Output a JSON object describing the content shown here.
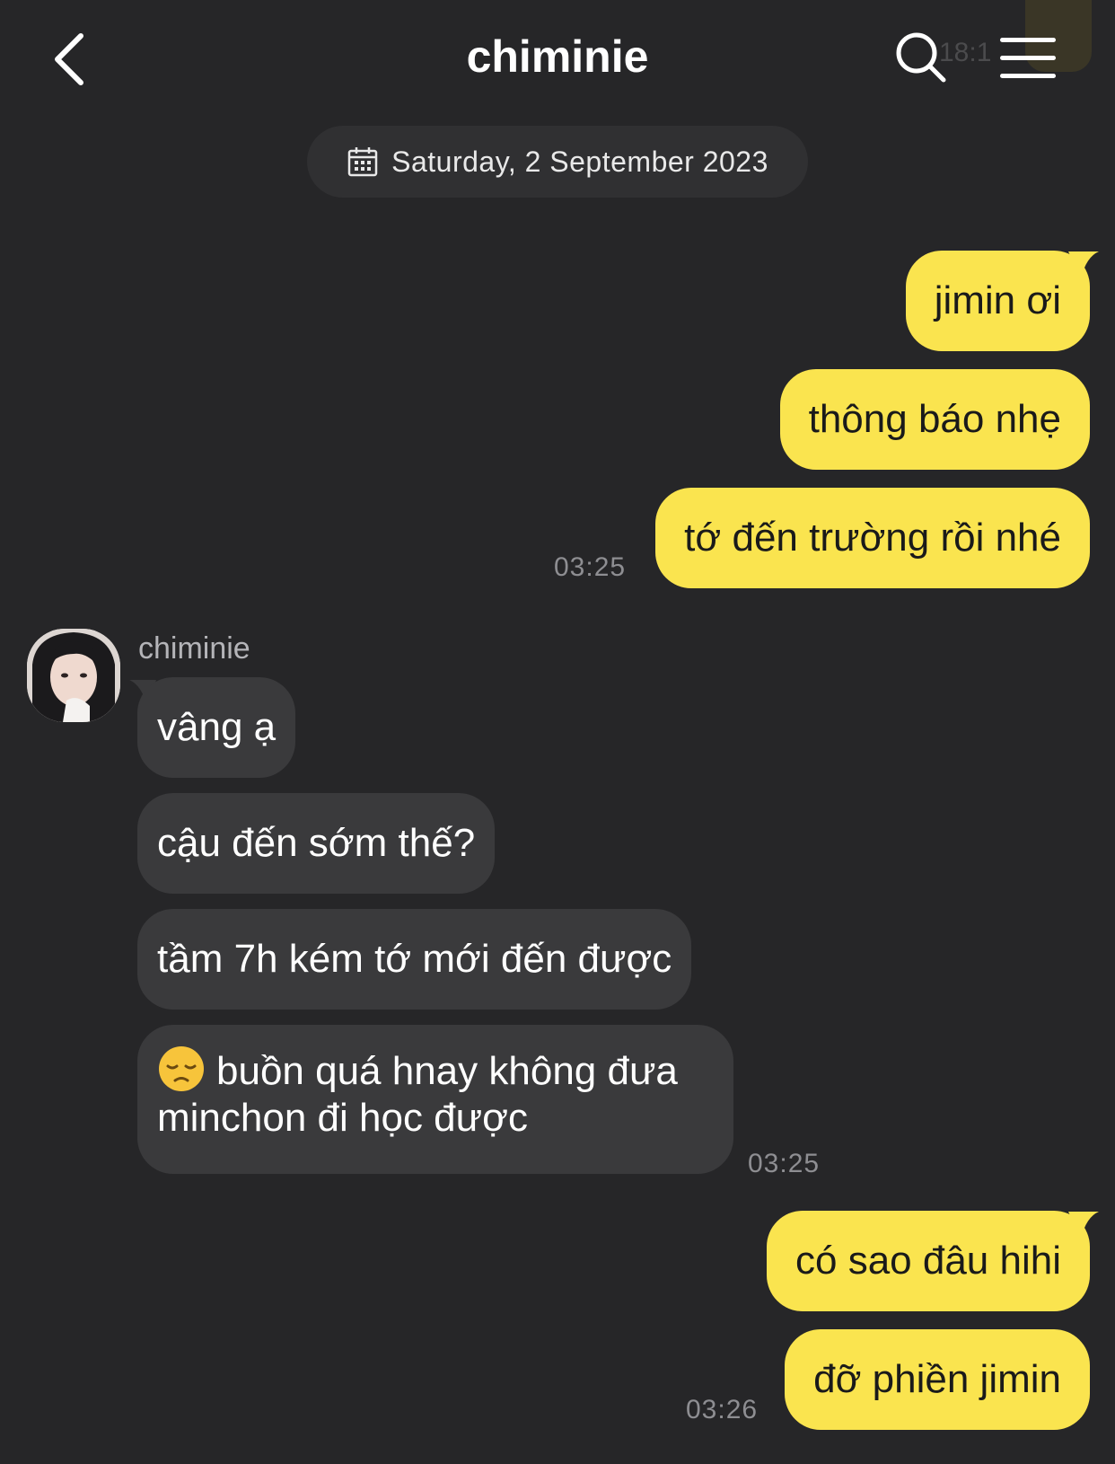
{
  "header": {
    "title": "chiminie",
    "ghost_time": "18:1",
    "back_icon": "chevron-left-icon",
    "search_icon": "search-icon",
    "menu_icon": "hamburger-menu-icon"
  },
  "date_divider": {
    "label": "Saturday, 2 September 2023",
    "icon": "calendar-icon"
  },
  "colors": {
    "background": "#262628",
    "my_bubble": "#fae44f",
    "their_bubble": "#3a3a3c",
    "timestamp": "#8e8e92"
  },
  "messages": {
    "me_1": {
      "text": "jimin ơi"
    },
    "me_2": {
      "text": "thông báo nhẹ"
    },
    "me_3": {
      "text": "tớ đến trường rồi nhé",
      "time": "03:25"
    },
    "them_sender": "chiminie",
    "them_1": {
      "text": "vâng ạ"
    },
    "them_2": {
      "text": "cậu đến sớm thế?"
    },
    "them_3": {
      "text": "tầm 7h kém tớ mới đến được"
    },
    "them_4": {
      "emoji": "pensive-face",
      "line1": "buồn quá hnay không đưa",
      "line2": "minchon đi học được",
      "time": "03:25"
    },
    "me_4": {
      "text": "có sao đâu hihi"
    },
    "me_5": {
      "text": "đỡ phiền jimin",
      "time": "03:26"
    }
  }
}
